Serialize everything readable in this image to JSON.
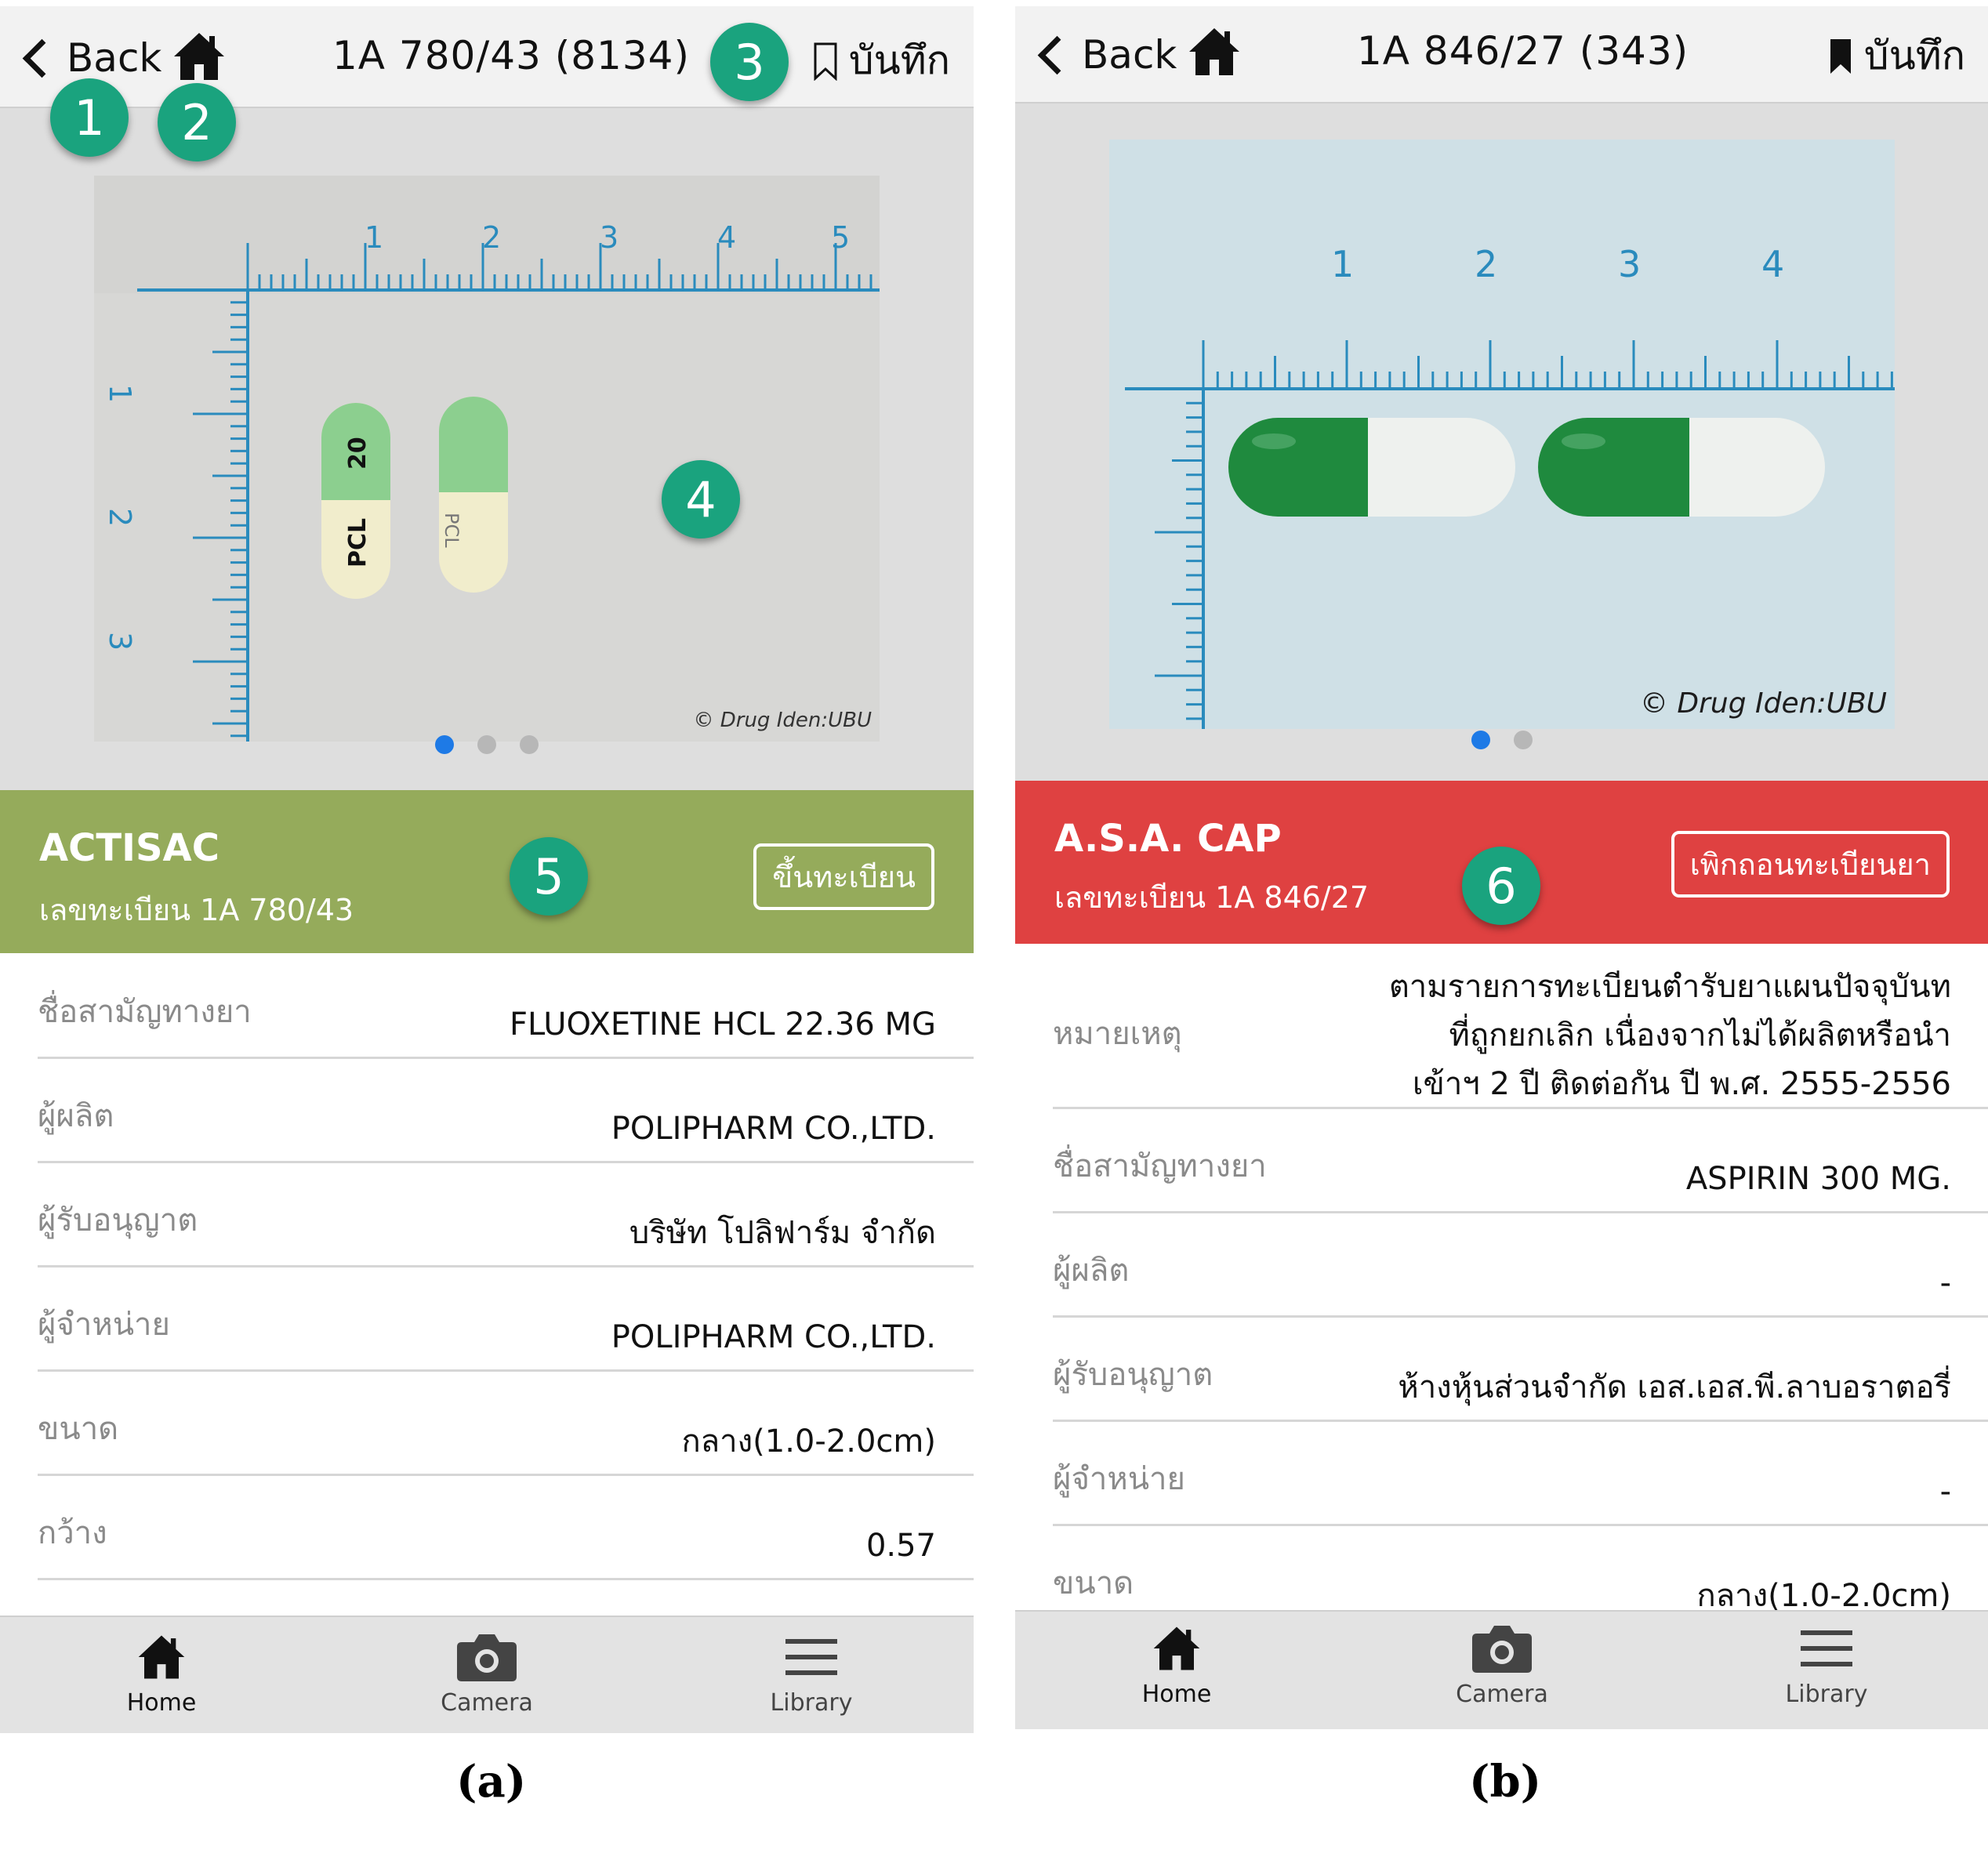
{
  "screen_a": {
    "header": {
      "back_label": "Back",
      "title": "1A 780/43 (8134)",
      "save_label": "บันทึก"
    },
    "image": {
      "watermark": "© Drug Iden:UBU",
      "ruler_top_ticks": [
        "1",
        "2",
        "3",
        "4",
        "5"
      ],
      "ruler_side_ticks": [
        "1",
        "2",
        "3"
      ],
      "capsule_imprint_1": "PCL",
      "capsule_imprint_2": "20",
      "capsule_imprint_3": "PCL",
      "pages": 3,
      "active_page": 1
    },
    "banner": {
      "name": "ACTISAC",
      "reg": "เลขทะเบียน 1A 780/43",
      "status": "ขึ้นทะเบียน",
      "color": "#95ab5b"
    },
    "rows": [
      {
        "label": "ชื่อสามัญทางยา",
        "value": "FLUOXETINE HCL 22.36 MG"
      },
      {
        "label": "ผู้ผลิต",
        "value": "POLIPHARM CO.,LTD."
      },
      {
        "label": "ผู้รับอนุญาต",
        "value": "บริษัท โปลิฟาร์ม จำกัด"
      },
      {
        "label": "ผู้จำหน่าย",
        "value": "POLIPHARM CO.,LTD."
      },
      {
        "label": "ขนาด",
        "value": "กลาง(1.0-2.0cm)"
      },
      {
        "label": "กว้าง",
        "value": "0.57"
      }
    ],
    "tabs": [
      "Home",
      "Camera",
      "Library"
    ],
    "caption": "(a)"
  },
  "screen_b": {
    "header": {
      "back_label": "Back",
      "title": "1A 846/27 (343)",
      "save_label": "บันทึก"
    },
    "image": {
      "watermark": "© Drug Iden:UBU",
      "ruler_top_ticks": [
        "1",
        "2",
        "3",
        "4"
      ],
      "pages": 2,
      "active_page": 1
    },
    "banner": {
      "name": "A.S.A. CAP",
      "reg": "เลขทะเบียน 1A 846/27",
      "status": "เพิกถอนทะเบียนยา",
      "color": "#df4141"
    },
    "note": {
      "label": "หมายเหตุ",
      "line1": "ตามรายการทะเบียนตำรับยาแผนปัจจุบันท",
      "line2": "ที่ถูกยกเลิก เนื่องจากไม่ได้ผลิตหรือนำ",
      "line3": "เข้าฯ 2 ปี ติดต่อกัน ปี พ.ศ. 2555-2556"
    },
    "rows": [
      {
        "label": "ชื่อสามัญทางยา",
        "value": "ASPIRIN 300 MG."
      },
      {
        "label": "ผู้ผลิต",
        "value": "-"
      },
      {
        "label": "ผู้รับอนุญาต",
        "value": "ห้างหุ้นส่วนจำกัด เอส.เอส.พี.ลาบอราตอรี่"
      },
      {
        "label": "ผู้จำหน่าย",
        "value": "-"
      },
      {
        "label": "ขนาด",
        "value": "กลาง(1.0-2.0cm)"
      }
    ],
    "tabs": [
      "Home",
      "Camera",
      "Library"
    ],
    "caption": "(b)"
  },
  "markers": [
    "1",
    "2",
    "3",
    "4",
    "5",
    "6"
  ],
  "colors": {
    "marker": "#1aa37e",
    "active_dot": "#1e7ae6",
    "ruler": "#2a8bbd"
  }
}
